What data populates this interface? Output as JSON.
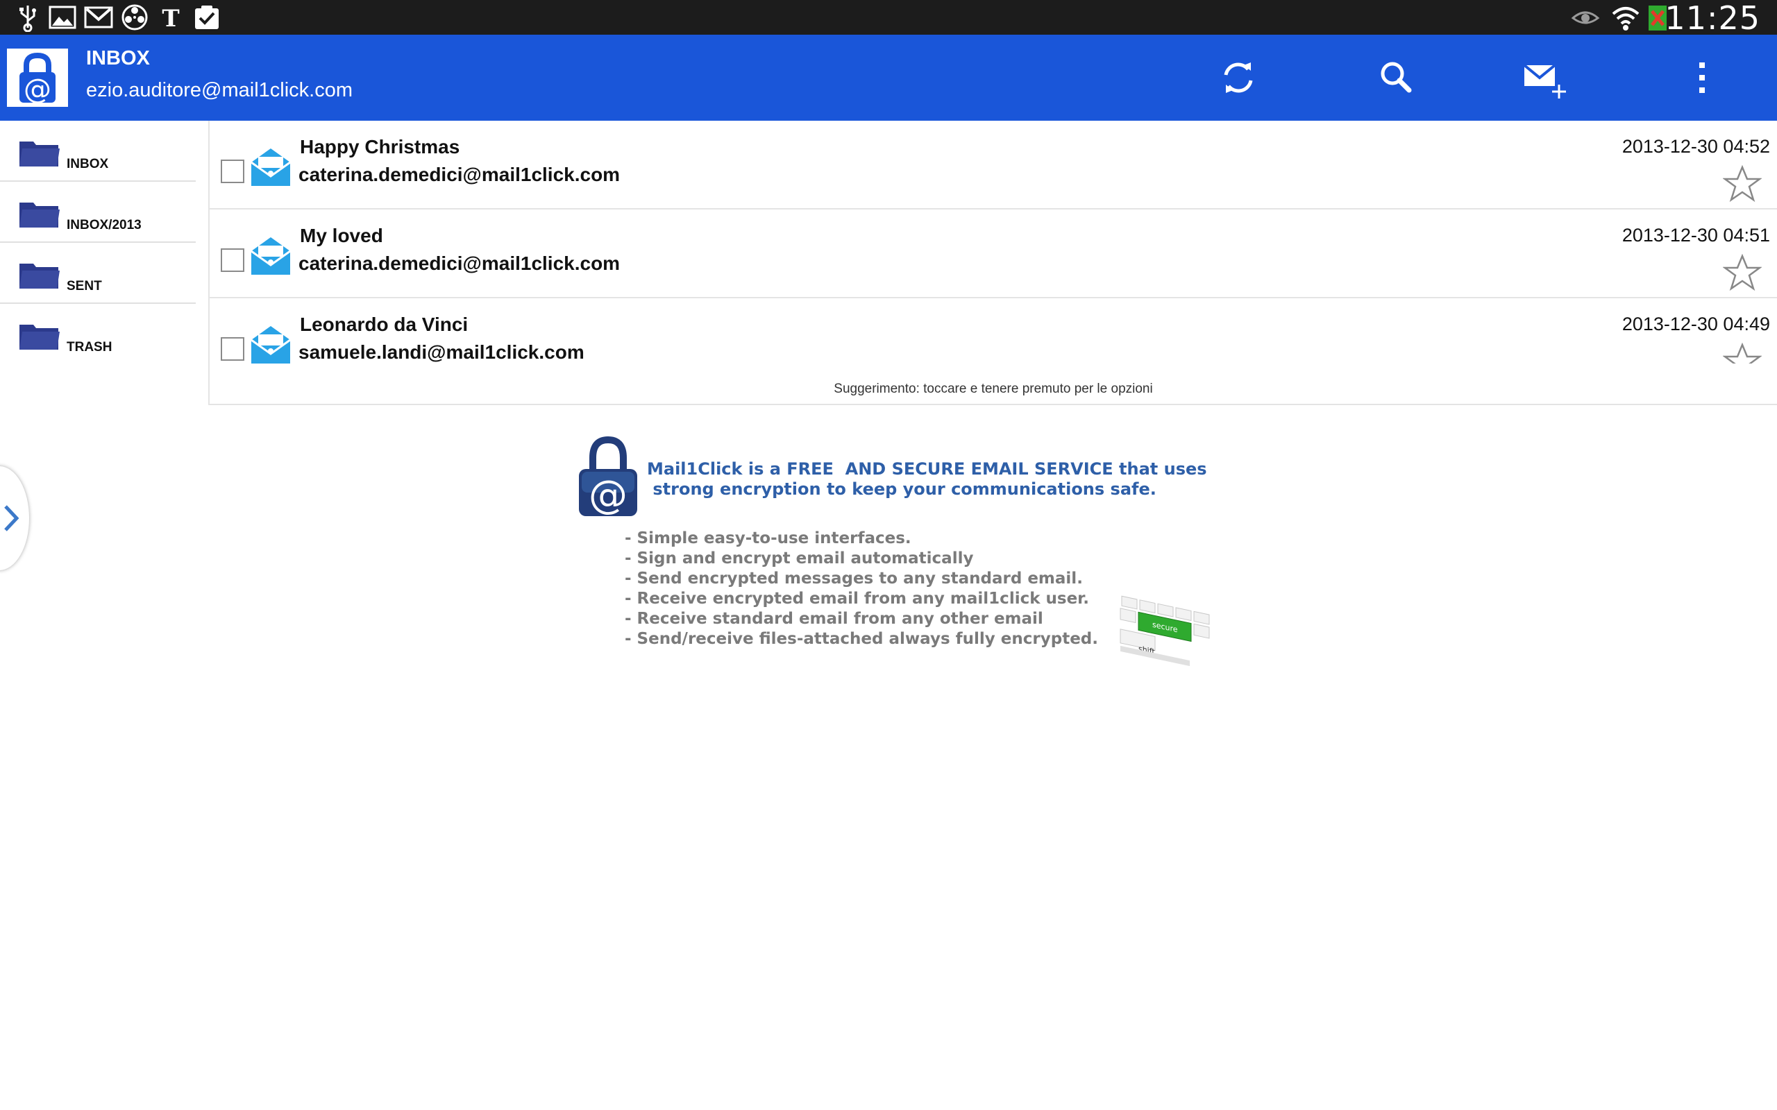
{
  "status_bar": {
    "clock": "11:25",
    "left_icons": [
      "usb-icon",
      "gallery-icon",
      "gmail-icon",
      "media-reel-icon",
      "nytimes-icon",
      "checkbox-task-icon"
    ],
    "right_icons": [
      "eye-icon",
      "wifi-icon",
      "battery-no-sim-icon"
    ]
  },
  "action_bar": {
    "title": "INBOX",
    "account": "ezio.auditore@mail1click.com",
    "actions": [
      "refresh-icon",
      "search-icon",
      "compose-mail-icon",
      "overflow-menu-icon"
    ]
  },
  "sidebar": {
    "folders": [
      {
        "label": "INBOX"
      },
      {
        "label": "INBOX/2013"
      },
      {
        "label": "SENT"
      },
      {
        "label": "TRASH"
      }
    ]
  },
  "messages": [
    {
      "subject": "Happy Christmas",
      "from": "caterina.demedici@mail1click.com",
      "date": "2013-12-30 04:52"
    },
    {
      "subject": "My loved",
      "from": "caterina.demedici@mail1click.com",
      "date": "2013-12-30 04:51"
    },
    {
      "subject": "Leonardo da Vinci",
      "from": "samuele.landi@mail1click.com",
      "date": "2013-12-30 04:49"
    }
  ],
  "hint": "Suggerimento: toccare e tenere premuto per le opzioni",
  "promo": {
    "headline_line1": "Mail1Click is a FREE  AND SECURE EMAIL SERVICE that uses",
    "headline_line2": " strong encryption to keep your communications safe.",
    "features": [
      "- Simple easy-to-use interfaces.",
      "- Sign and encrypt email automatically",
      "- Send encrypted messages to any standard email.",
      "- Receive encrypted email from any mail1click user.",
      "- Receive standard email from any other email",
      "- Send/receive files-attached always fully encrypted."
    ],
    "keyboard_key_label": "secure",
    "keyboard_shift_label": "shift"
  },
  "colors": {
    "action_bar": "#1a56d9",
    "status_bar": "#1c1c1c",
    "folder_icon": "#3a4aa0",
    "mail_icon": "#29a3e6",
    "promo_headline": "#2e5fa8",
    "promo_text": "#7a7a7a",
    "secure_key": "#2faa2f"
  }
}
